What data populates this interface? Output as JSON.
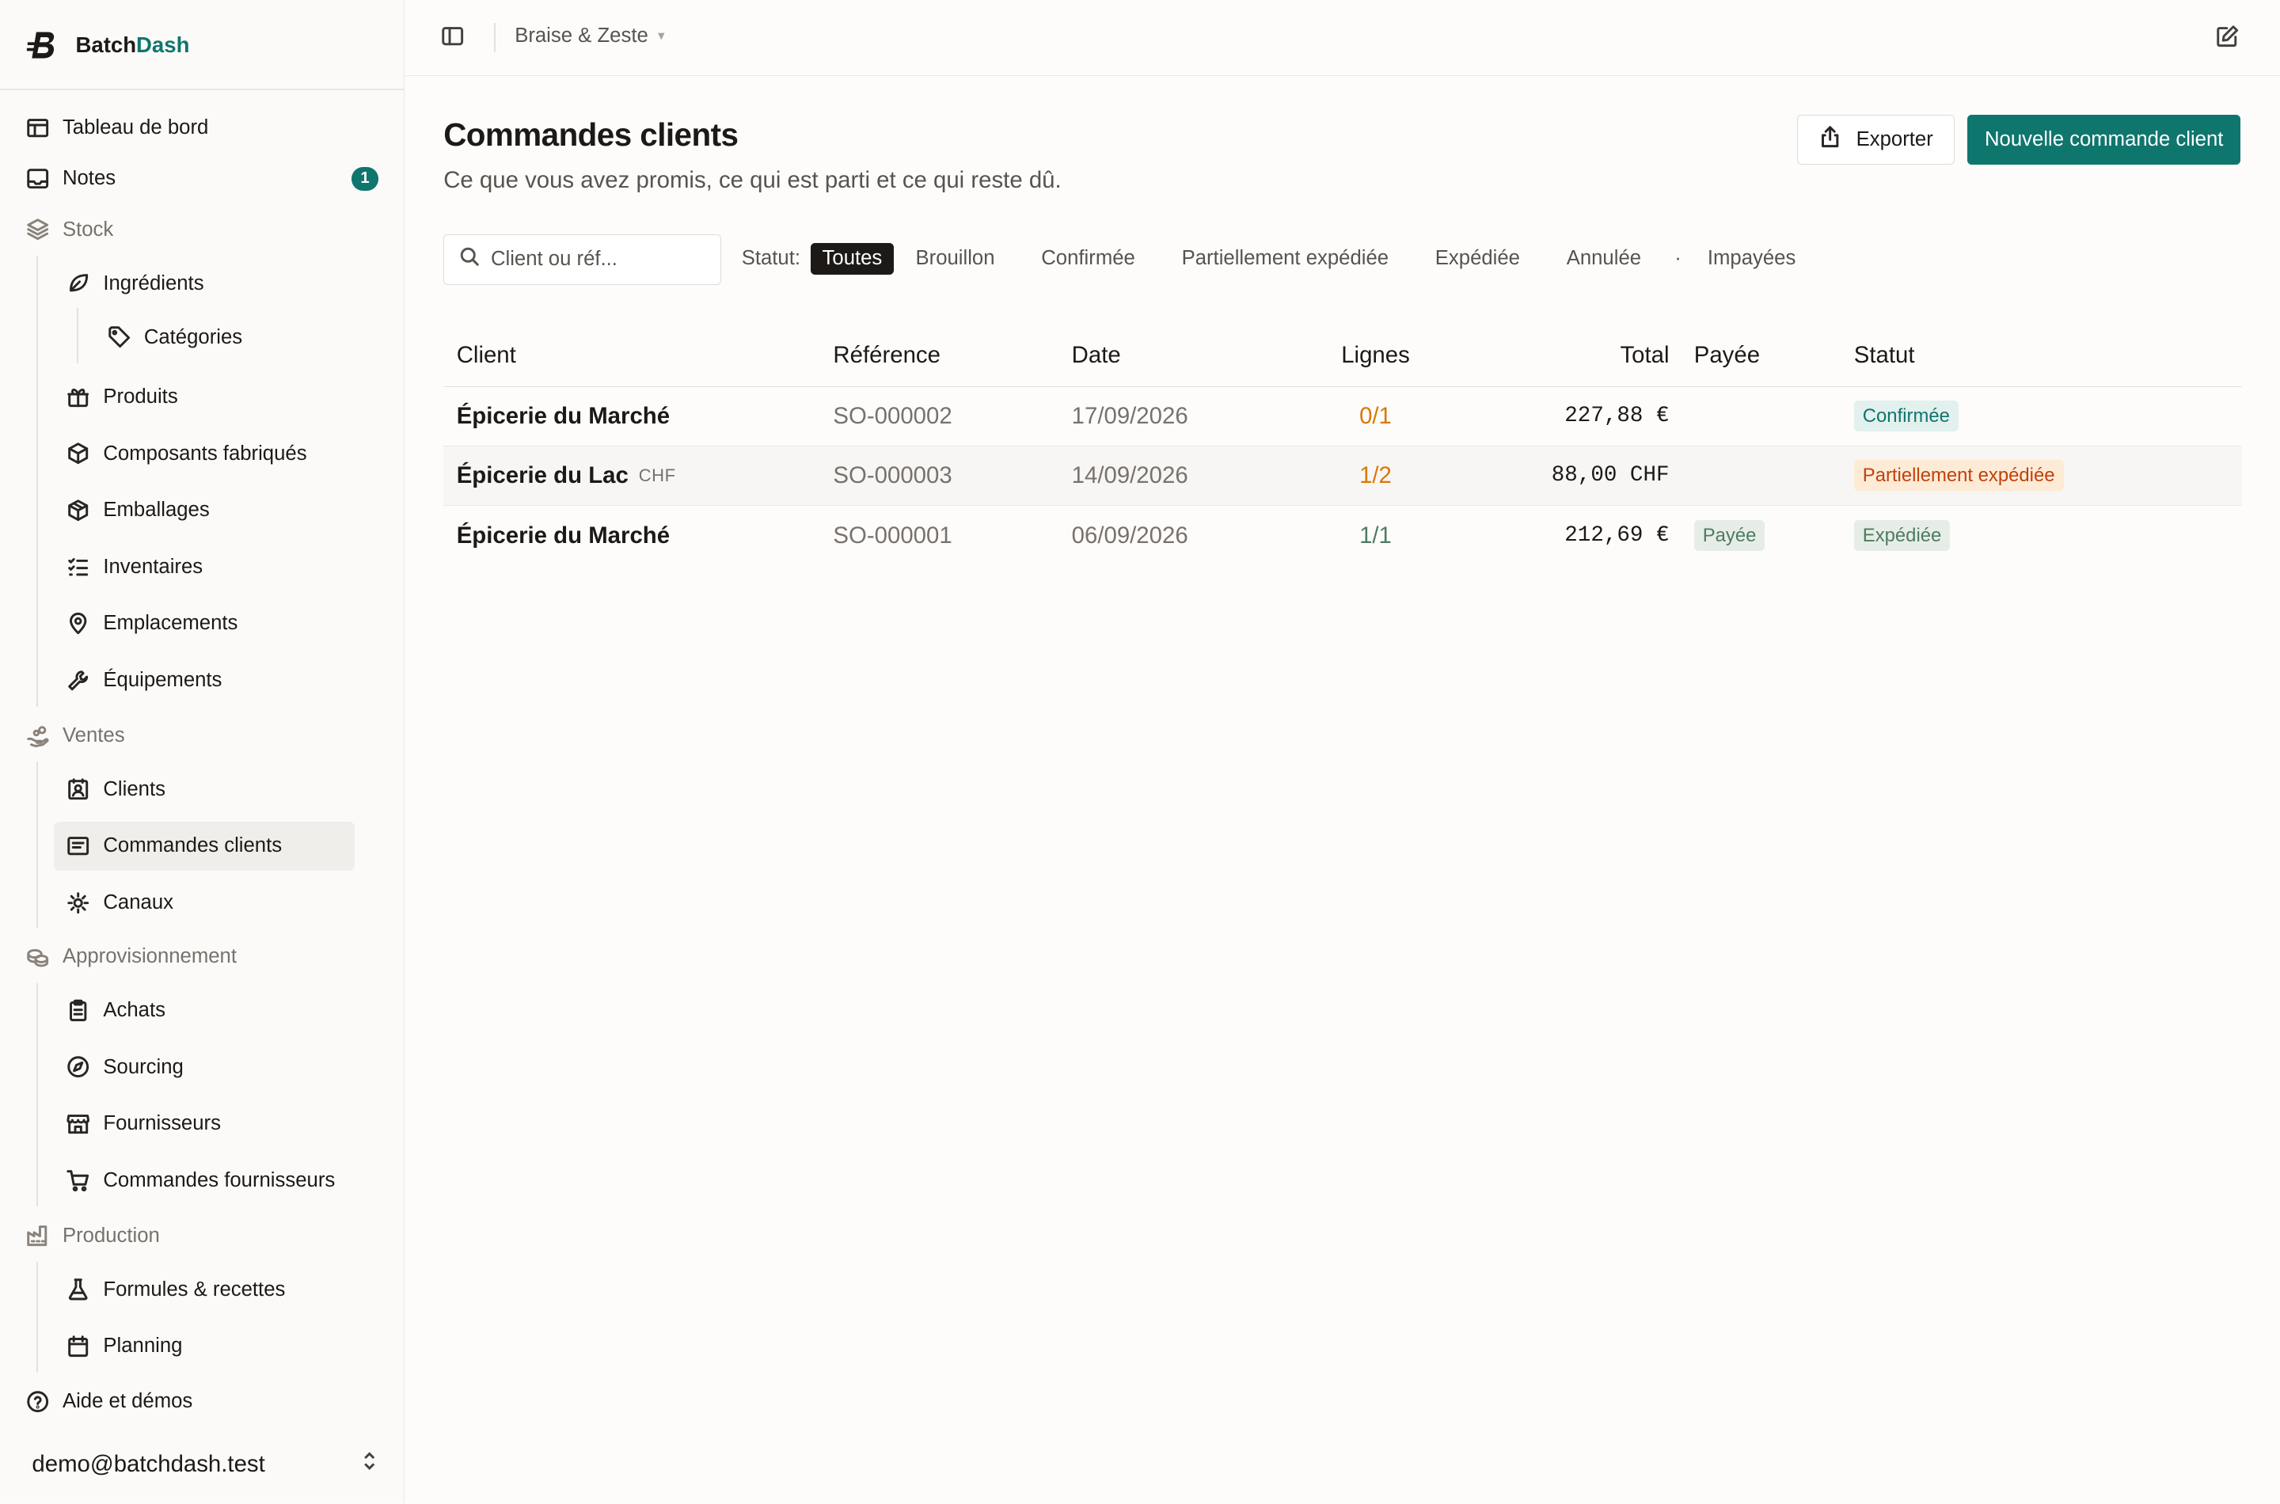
{
  "app": {
    "name_prefix": "Batch",
    "name_accent": "Dash",
    "workspace": "Braise & Zeste"
  },
  "colors": {
    "accent": "#0f766e",
    "warning": "#c2410c",
    "success": "#4d7c5f"
  },
  "sidebar": {
    "dashboard": "Tableau de bord",
    "notes": "Notes",
    "notes_count": "1",
    "stock": "Stock",
    "ingredients": "Ingrédients",
    "categories": "Catégories",
    "products": "Produits",
    "components": "Composants fabriqués",
    "packaging": "Emballages",
    "inventories": "Inventaires",
    "locations": "Emplacements",
    "equipment": "Équipements",
    "sales": "Ventes",
    "clients": "Clients",
    "client_orders": "Commandes clients",
    "channels": "Canaux",
    "procurement": "Approvisionnement",
    "purchases": "Achats",
    "sourcing": "Sourcing",
    "suppliers": "Fournisseurs",
    "supplier_orders": "Commandes fournisseurs",
    "production": "Production",
    "recipes": "Formules & recettes",
    "planning": "Planning",
    "help": "Aide et démos",
    "user": "demo@batchdash.test"
  },
  "page": {
    "title": "Commandes clients",
    "subtitle": "Ce que vous avez promis, ce qui est parti et ce qui reste dû.",
    "export_label": "Exporter",
    "new_label": "Nouvelle commande client"
  },
  "filters": {
    "search_placeholder": "Client ou réf...",
    "status_label": "Statut:",
    "all": "Toutes",
    "draft": "Brouillon",
    "confirmed": "Confirmée",
    "partial": "Partiellement expédiée",
    "shipped": "Expédiée",
    "cancelled": "Annulée",
    "dot": "·",
    "unpaid": "Impayées"
  },
  "table": {
    "headers": {
      "client": "Client",
      "ref": "Référence",
      "date": "Date",
      "lines": "Lignes",
      "total": "Total",
      "paid": "Payée",
      "status": "Statut"
    },
    "rows": [
      {
        "client": "Épicerie du Marché",
        "currency": "",
        "ref": "SO-000002",
        "date": "17/09/2026",
        "lines": "0/1",
        "lines_color": "#d97706",
        "total": "227,88 €",
        "paid": "",
        "status": "Confirmée",
        "status_bg": "#e2f0ee",
        "status_fg": "#0f766e"
      },
      {
        "client": "Épicerie du Lac",
        "currency": "CHF",
        "ref": "SO-000003",
        "date": "14/09/2026",
        "lines": "1/2",
        "lines_color": "#d97706",
        "total": "88,00 CHF",
        "paid": "",
        "status": "Partiellement expédiée",
        "status_bg": "#fdebd6",
        "status_fg": "#c2410c"
      },
      {
        "client": "Épicerie du Marché",
        "currency": "",
        "ref": "SO-000001",
        "date": "06/09/2026",
        "lines": "1/1",
        "lines_color": "#4d7c5f",
        "total": "212,69 €",
        "paid": "Payée",
        "status": "Expédiée",
        "status_bg": "#e6ede7",
        "status_fg": "#4d7c5f"
      }
    ]
  }
}
